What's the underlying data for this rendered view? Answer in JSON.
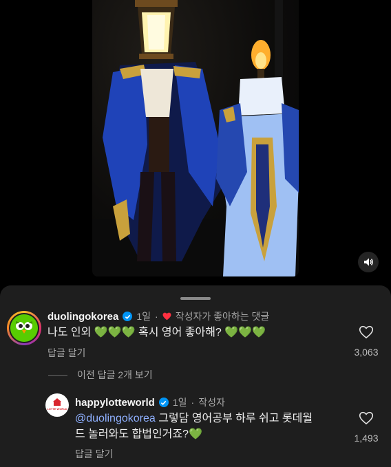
{
  "media": {
    "mute_icon": "speaker-icon"
  },
  "comments": [
    {
      "username": "duolingokorea",
      "time": "1일",
      "separator": "·",
      "creator_liked_label": "작성자가 좋아하는 댓글",
      "text_main": "나도 인외",
      "text_mid": "혹시 영어 좋아해?",
      "emoji": "💚",
      "reply_label": "답글 달기",
      "like_count": "3,063"
    }
  ],
  "view_previous_label": "이전 답글 2개 보기",
  "reply": {
    "username": "happylotteworld",
    "time": "1일",
    "separator": "·",
    "author_badge": "작성자",
    "mention": "@duolingokorea",
    "text_line1": "그렇담 영어공부 하루 쉬고 롯데월",
    "text_line2": "드 놀러와도 합법인거죠?",
    "emoji": "💚",
    "reply_label": "답글 달기",
    "like_count": "1,493",
    "avatar_text": "LOTTE WORLD"
  },
  "colors": {
    "background": "#000000",
    "sheet": "#1e1e1e",
    "verified": "#0095f6",
    "heart_red": "#ff3040",
    "mention": "#8fb0ff",
    "duo_green": "#58cc02"
  }
}
